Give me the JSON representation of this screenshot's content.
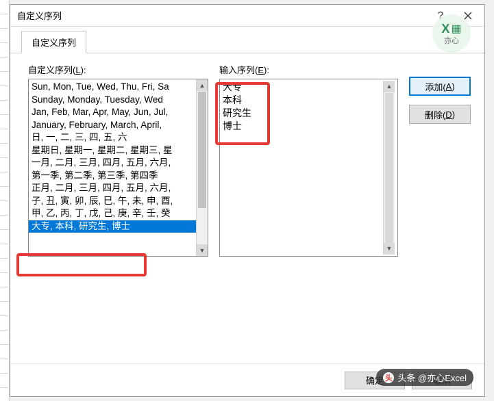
{
  "dialog": {
    "title": "自定义序列",
    "help_symbol": "?",
    "tab_label": "自定义序列"
  },
  "left": {
    "label_prefix": "自定义序列(",
    "label_key": "L",
    "label_suffix": "):",
    "items": [
      "Sun, Mon, Tue, Wed, Thu, Fri, Sa",
      "Sunday, Monday, Tuesday, Wed",
      "Jan, Feb, Mar, Apr, May, Jun, Jul,",
      "January, February, March, April,",
      "日, 一, 二, 三, 四, 五, 六",
      "星期日, 星期一, 星期二, 星期三, 星",
      "一月, 二月, 三月, 四月, 五月, 六月,",
      "第一季, 第二季, 第三季, 第四季",
      "正月, 二月, 三月, 四月, 五月, 六月,",
      "子, 丑, 寅, 卯, 辰, 巳, 午, 未, 申, 酉,",
      "甲, 乙, 丙, 丁, 戊, 己, 庚, 辛, 壬, 癸"
    ],
    "selected_item": "大专, 本科, 研究生, 博士"
  },
  "mid": {
    "label_prefix": "输入序列(",
    "label_key": "E",
    "label_suffix": "):",
    "text": "大专\n本科\n研究生\n博士"
  },
  "right": {
    "add_prefix": "添加(",
    "add_key": "A",
    "add_suffix": ")",
    "delete_prefix": "删除(",
    "delete_key": "D",
    "delete_suffix": ")"
  },
  "footer": {
    "ok": "确定",
    "cancel": "取消"
  },
  "watermark": {
    "text": "头条 @亦心Excel"
  },
  "logo": {
    "text": "亦心"
  }
}
